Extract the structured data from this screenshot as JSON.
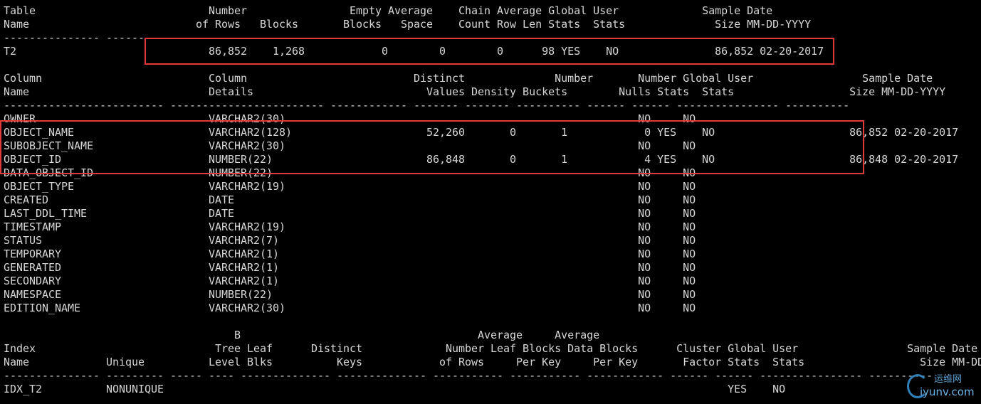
{
  "terminal": {
    "lines": [
      "Table                           Number                Empty Average    Chain Average Global User             Sample Date",
      "Name                          of Rows   Blocks       Blocks   Space    Count Row Len Stats  Stats              Size MM-DD-YYYY",
      "--------------- -------------- ------------ ------------ -------- -------- ------- ------ ------ -------------- ----------",
      "T2                              86,852    1,268            0        0        0      98 YES    NO               86,852 02-20-2017",
      "",
      "Column                          Column                          Distinct              Number       Number Global User                 Sample Date",
      "Name                            Details                           Values Density Buckets        Nulls Stats  Stats                  Size MM-DD-YYYY",
      "------------------------- ------------------------ ------------ ------- ------- ---------- ------ ------ ---------------- ----------",
      "OWNER                           VARCHAR2(30)                                                       NO     NO",
      "OBJECT_NAME                     VARCHAR2(128)                     52,260       0       1            0 YES    NO                     86,852 02-20-2017",
      "SUBOBJECT_NAME                  VARCHAR2(30)                                                       NO     NO",
      "OBJECT_ID                       NUMBER(22)                        86,848       0       1            4 YES    NO                     86,848 02-20-2017",
      "DATA_OBJECT_ID                  NUMBER(22)                                                         NO     NO",
      "OBJECT_TYPE                     VARCHAR2(19)                                                       NO     NO",
      "CREATED                         DATE                                                               NO     NO",
      "LAST_DDL_TIME                   DATE                                                               NO     NO",
      "TIMESTAMP                       VARCHAR2(19)                                                       NO     NO",
      "STATUS                          VARCHAR2(7)                                                        NO     NO",
      "TEMPORARY                       VARCHAR2(1)                                                        NO     NO",
      "GENERATED                       VARCHAR2(1)                                                        NO     NO",
      "SECONDARY                       VARCHAR2(1)                                                        NO     NO",
      "NAMESPACE                       NUMBER(22)                                                         NO     NO",
      "EDITION_NAME                    VARCHAR2(30)                                                       NO     NO",
      "",
      "                                    B                                     Average     Average",
      "Index                            Tree Leaf      Distinct             Number Leaf Blocks Data Blocks      Cluster Global User                 Sample Date",
      "Name            Unique          Level Blks          Keys            of Rows     Per Key     Per Key       Factor Stats  Stats                  Size MM-DD-YYYY",
      "--------------- --------- ----- ---- -------------- -------------- ----------- ----------- ------------ ------ ------ ---------------- ----------",
      "IDX_T2          NONUNIQUE                                                                                        YES    NO"
    ]
  },
  "watermark": {
    "cn": "运维网",
    "url": "iyunv.com"
  },
  "colors": {
    "background": "#000000",
    "text": "#d6d6d6",
    "highlight": "#e03a3a"
  }
}
